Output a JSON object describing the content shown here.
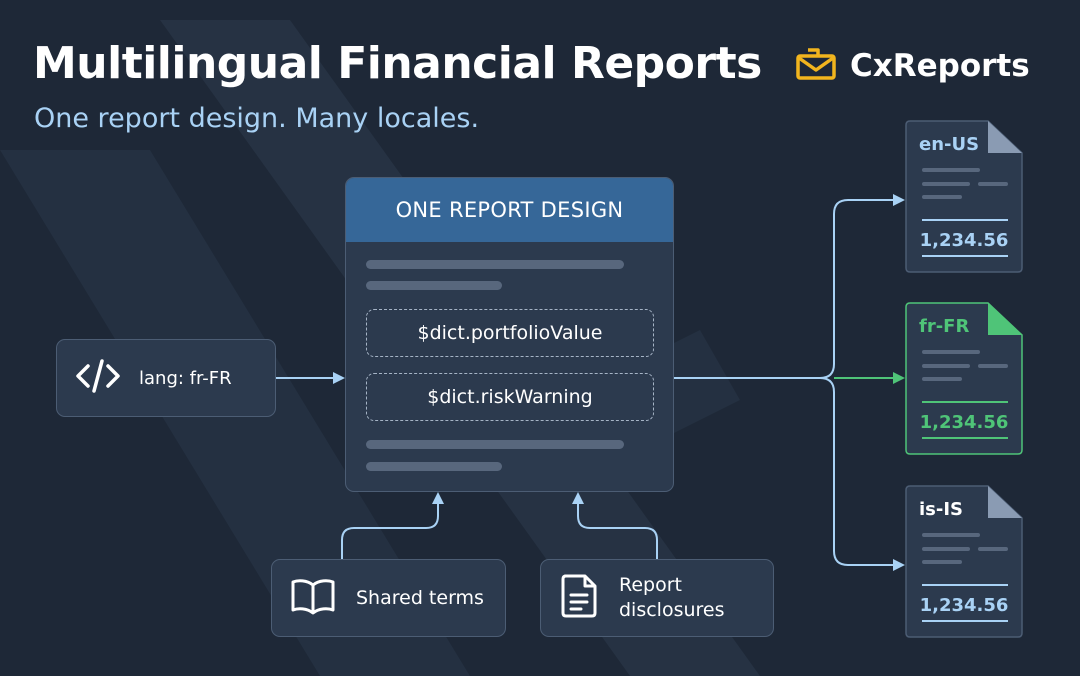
{
  "header": {
    "title": "Multilingual Financial Reports",
    "subtitle": "One report design. Many locales."
  },
  "brand": {
    "name": "CxReports",
    "logo_icon": "envelope-logo-icon"
  },
  "design_card": {
    "heading": "ONE REPORT DESIGN",
    "tokens": [
      "$dict.portfolioValue",
      "$dict.riskWarning"
    ]
  },
  "input": {
    "label": "lang: fr-FR",
    "icon": "code-icon"
  },
  "sources": [
    {
      "label": "Shared terms",
      "icon": "book-icon"
    },
    {
      "label": "Report\ndisclosures",
      "icon": "document-icon"
    }
  ],
  "outputs": [
    {
      "locale": "en-US",
      "value": "1,234.56",
      "highlighted": false
    },
    {
      "locale": "fr-FR",
      "value": "1,234.56",
      "highlighted": true
    },
    {
      "locale": "is-IS",
      "value": "1,234.56",
      "highlighted": false
    }
  ],
  "colors": {
    "background": "#1e2837",
    "card": "#2c3a4e",
    "card_border": "#4c5d74",
    "design_header": "#366798",
    "accent_blue": "#a9d2f5",
    "accent_green": "#4fc478",
    "brand_yellow": "#f2b51e"
  }
}
